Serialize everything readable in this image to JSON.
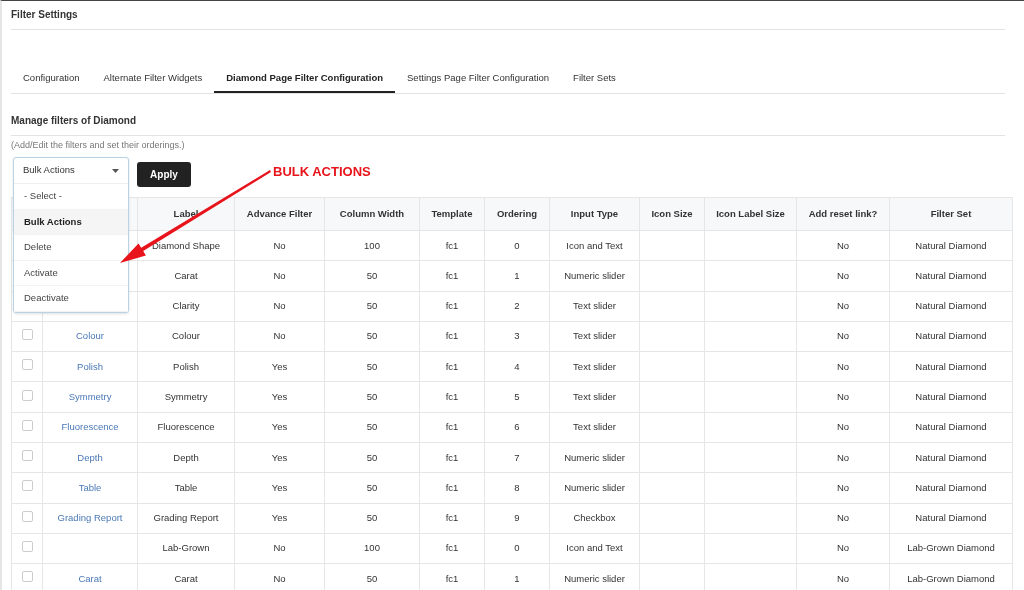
{
  "page_title": "Filter Settings",
  "tabs": [
    {
      "label": "Configuration",
      "selected": false
    },
    {
      "label": "Alternate Filter Widgets",
      "selected": false
    },
    {
      "label": "Diamond Page Filter Configuration",
      "selected": true
    },
    {
      "label": "Settings Page Filter Configuration",
      "selected": false
    },
    {
      "label": "Filter Sets",
      "selected": false
    }
  ],
  "section_title": "Manage filters of Diamond",
  "section_hint": "(Add/Edit the filters and set their orderings.)",
  "bulk_select": {
    "value": "Bulk Actions",
    "expanded": true,
    "options": [
      {
        "label": "- Select -",
        "selected": false
      },
      {
        "label": "Bulk Actions",
        "selected": true
      },
      {
        "label": "Delete",
        "selected": false
      },
      {
        "label": "Activate",
        "selected": false
      },
      {
        "label": "Deactivate",
        "selected": false
      }
    ]
  },
  "apply_button": "Apply",
  "annotation": "BULK ACTIONS",
  "table": {
    "columns": [
      "Label",
      "Advance Filter",
      "Column Width",
      "Template",
      "Ordering",
      "Input Type",
      "Icon Size",
      "Icon Label Size",
      "Add reset link?",
      "Filter Set"
    ],
    "rows": [
      {
        "cells": [
          "Diamond Shape",
          "No",
          "100",
          "fc1",
          "0",
          "Icon and Text",
          "",
          "",
          "No",
          "Natural Diamond"
        ]
      },
      {
        "cells": [
          "Carat",
          "No",
          "50",
          "fc1",
          "1",
          "Numeric slider",
          "",
          "",
          "No",
          "Natural Diamond"
        ]
      },
      {
        "cells": [
          "Clarity",
          "No",
          "50",
          "fc1",
          "2",
          "Text slider",
          "",
          "",
          "No",
          "Natural Diamond"
        ]
      },
      {
        "checked": false,
        "name": "Colour",
        "cells": [
          "Colour",
          "No",
          "50",
          "fc1",
          "3",
          "Text slider",
          "",
          "",
          "No",
          "Natural Diamond"
        ]
      },
      {
        "checked": false,
        "name": "Polish",
        "cells": [
          "Polish",
          "Yes",
          "50",
          "fc1",
          "4",
          "Text slider",
          "",
          "",
          "No",
          "Natural Diamond"
        ]
      },
      {
        "checked": false,
        "name": "Symmetry",
        "cells": [
          "Symmetry",
          "Yes",
          "50",
          "fc1",
          "5",
          "Text slider",
          "",
          "",
          "No",
          "Natural Diamond"
        ]
      },
      {
        "checked": false,
        "name": "Fluorescence",
        "cells": [
          "Fluorescence",
          "Yes",
          "50",
          "fc1",
          "6",
          "Text slider",
          "",
          "",
          "No",
          "Natural Diamond"
        ]
      },
      {
        "checked": false,
        "name": "Depth",
        "cells": [
          "Depth",
          "Yes",
          "50",
          "fc1",
          "7",
          "Numeric slider",
          "",
          "",
          "No",
          "Natural Diamond"
        ]
      },
      {
        "checked": false,
        "name": "Table",
        "cells": [
          "Table",
          "Yes",
          "50",
          "fc1",
          "8",
          "Numeric slider",
          "",
          "",
          "No",
          "Natural Diamond"
        ]
      },
      {
        "checked": false,
        "name": "Grading Report",
        "cells": [
          "Grading Report",
          "Yes",
          "50",
          "fc1",
          "9",
          "Checkbox",
          "",
          "",
          "No",
          "Natural Diamond"
        ]
      },
      {
        "checked": false,
        "cells": [
          "Lab-Grown",
          "No",
          "100",
          "fc1",
          "0",
          "Icon and Text",
          "",
          "",
          "No",
          "Lab-Grown Diamond"
        ]
      },
      {
        "checked": false,
        "name": "Carat",
        "cells": [
          "Carat",
          "No",
          "50",
          "fc1",
          "1",
          "Numeric slider",
          "",
          "",
          "No",
          "Lab-Grown Diamond"
        ]
      }
    ]
  }
}
